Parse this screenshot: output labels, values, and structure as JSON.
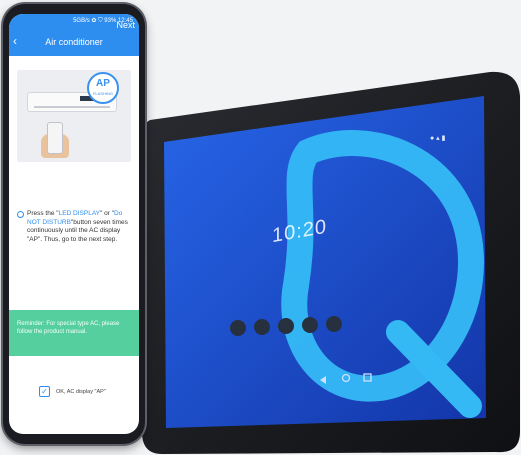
{
  "phone": {
    "status_text": "5GB/s ✿ ⛉ 93% 12:45",
    "app_title": "Air conditioner",
    "back_icon": "chevron-left-icon",
    "next_label": "Next",
    "illustration": {
      "badge_text": "AP",
      "badge_sub": "FLASHING"
    },
    "instruction": {
      "part1": "Press the \"",
      "highlight1": "LED DISPLAY",
      "part2": "\" or \"",
      "highlight2": "Do NOT DISTURB",
      "part3": "\"button seven times continuously until the AC display \"AP\". Thus, go to the next step."
    },
    "reminder": "Reminder: For special type AC, please follow the product manual.",
    "confirm_label": "OK, AC display \"AP\""
  },
  "tablet": {
    "time": "10:20",
    "status": "● ▴ ▮",
    "app_icons": [
      "app-icon-1",
      "app-icon-2",
      "app-icon-3",
      "app-icon-4",
      "app-icon-5"
    ]
  },
  "colors": {
    "phone_accent": "#2e8ef0",
    "reminder_bg": "#56cf9f",
    "tablet_screen": "#1d4fd8",
    "tablet_logo": "#35b9f5"
  }
}
